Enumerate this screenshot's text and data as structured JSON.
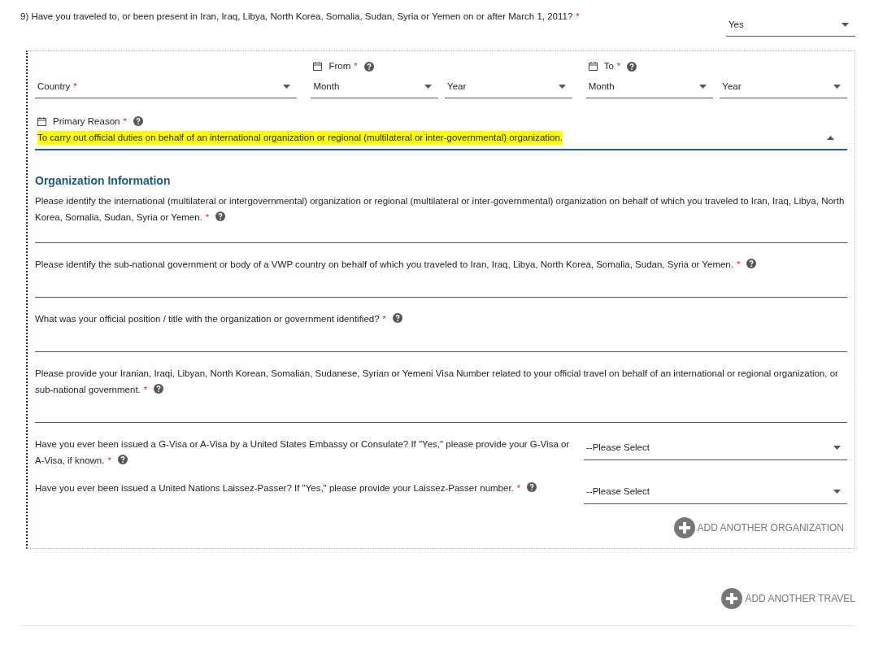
{
  "question": {
    "text": "9) Have you traveled to, or been present in Iran, Iraq, Libya, North Korea, Somalia, Sudan, Syria or Yemen on or after March 1, 2011?",
    "mark": "*",
    "answer": "Yes"
  },
  "travel": {
    "country": {
      "placeholder": "Country",
      "mark": "*"
    },
    "dates": [
      {
        "label": "From",
        "mark": "*",
        "month": "Month",
        "year": "Year"
      },
      {
        "label": "To",
        "mark": "*",
        "month": "Month",
        "year": "Year"
      }
    ],
    "primary_reason": {
      "label": "Primary Reason",
      "mark": "*",
      "value": "To carry out official duties on behalf of an international organization or regional (multilateral or inter-governmental) organization.",
      "highlighted": true,
      "open": true
    },
    "organization": {
      "heading": "Organization Information",
      "questions": [
        {
          "kind": "text",
          "text": "Please identify the international (multilateral or intergovernmental) organization or regional (multilateral or inter-governmental) organization on behalf of which you traveled to Iran, Iraq, Libya, North Korea, Somalia, Sudan, Syria or Yemen.",
          "mark": "*"
        },
        {
          "kind": "text",
          "text": "Please identify the sub-national government or body of a VWP country on behalf of which you traveled to Iran, Iraq, Libya, North Korea, Somalia, Sudan, Syria or Yemen.",
          "mark": "*"
        },
        {
          "kind": "text",
          "text": "What was your official position / title with the organization or government identified?",
          "mark": "*"
        },
        {
          "kind": "text",
          "text": "Please provide your Iranian, Iraqi, Libyan, North Korean, Somalian, Sudanese, Syrian or Yemeni Visa Number related to your official travel on behalf of an international or regional organization, or sub-national government.",
          "mark": "*"
        },
        {
          "kind": "select",
          "text": "Have you ever been issued a G-Visa or A-Visa by a United States Embassy or Consulate? If \"Yes,\" please provide your G-Visa or A-Visa, if known.",
          "mark": "*",
          "value": "--Please Select"
        },
        {
          "kind": "select",
          "text": "Have you ever been issued a United Nations Laissez-Passer? If \"Yes,\" please provide your Laissez-Passer number.",
          "mark": "*",
          "value": "--Please Select"
        }
      ],
      "add_button": "ADD ANOTHER ORGANIZATION"
    }
  },
  "add_travel": "ADD ANOTHER TRAVEL"
}
